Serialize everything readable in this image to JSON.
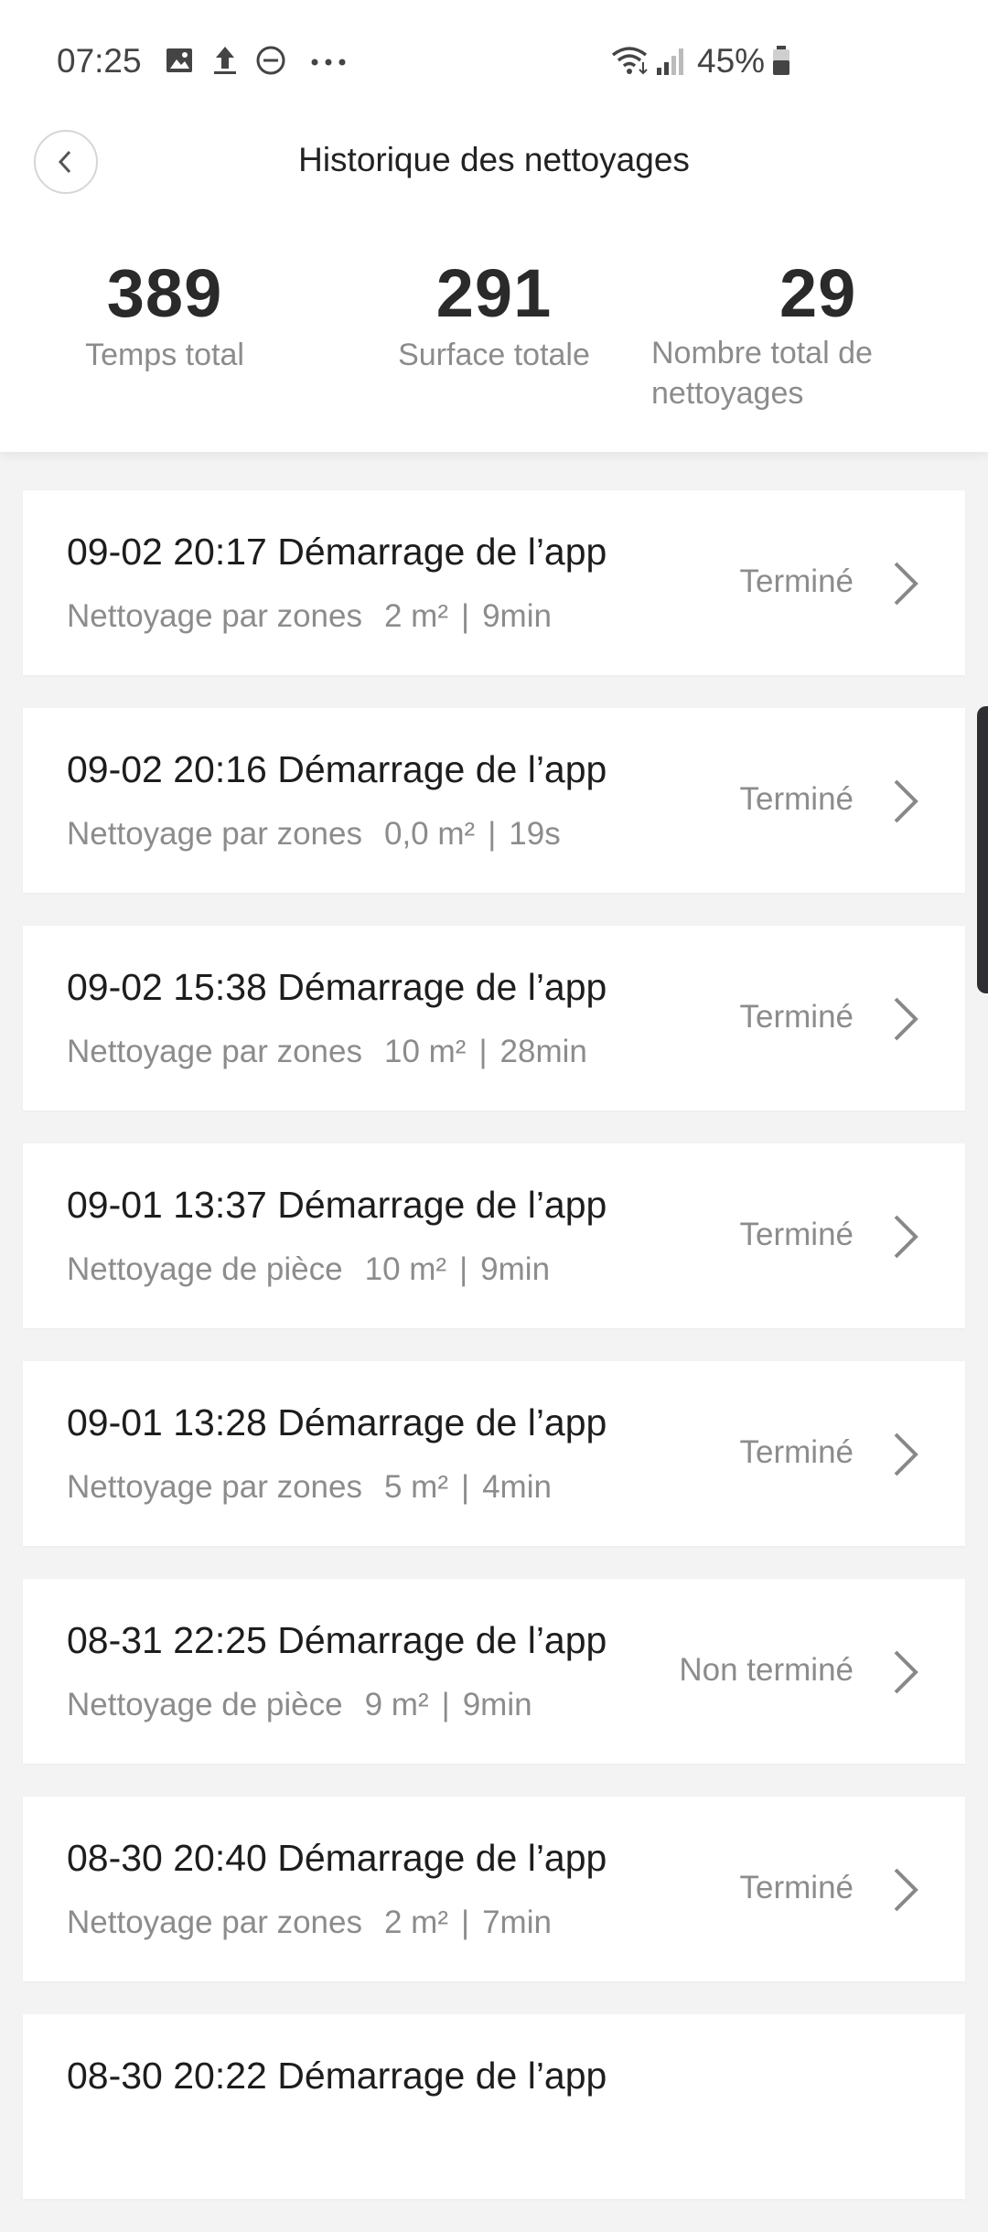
{
  "status_bar": {
    "time": "07:25",
    "battery": "45%",
    "icons": [
      "gallery-icon",
      "upload-icon",
      "do-not-disturb-icon",
      "more-dots-icon",
      "wifi-icon",
      "signal-icon",
      "battery-icon"
    ]
  },
  "header": {
    "title": "Historique des nettoyages",
    "back_icon": "chevron-left-icon"
  },
  "stats": [
    {
      "value": "389",
      "label": "Temps total"
    },
    {
      "value": "291",
      "label": "Surface totale"
    },
    {
      "value": "29",
      "label": "Nombre total de nettoyages"
    }
  ],
  "records": [
    {
      "title": "09-02 20:17 Démarrage de l’app",
      "mode": "Nettoyage par zones",
      "area": "2 m²",
      "sep": "|",
      "duration": "9min",
      "status": "Terminé"
    },
    {
      "title": "09-02 20:16 Démarrage de l’app",
      "mode": "Nettoyage par zones",
      "area": "0,0 m²",
      "sep": "|",
      "duration": "19s",
      "status": "Terminé"
    },
    {
      "title": "09-02 15:38 Démarrage de l’app",
      "mode": "Nettoyage par zones",
      "area": "10 m²",
      "sep": "|",
      "duration": "28min",
      "status": "Terminé"
    },
    {
      "title": "09-01 13:37 Démarrage de l’app",
      "mode": "Nettoyage de pièce",
      "area": "10 m²",
      "sep": "|",
      "duration": "9min",
      "status": "Terminé"
    },
    {
      "title": "09-01 13:28 Démarrage de l’app",
      "mode": "Nettoyage par zones",
      "area": "5 m²",
      "sep": "|",
      "duration": "4min",
      "status": "Terminé"
    },
    {
      "title": "08-31 22:25 Démarrage de l’app",
      "mode": "Nettoyage de pièce",
      "area": "9 m²",
      "sep": "|",
      "duration": "9min",
      "status": "Non terminé"
    },
    {
      "title": "08-30 20:40 Démarrage de l’app",
      "mode": "Nettoyage par zones",
      "area": "2 m²",
      "sep": "|",
      "duration": "7min",
      "status": "Terminé"
    },
    {
      "title": "08-30 20:22 Démarrage de l’app",
      "mode": "",
      "area": "",
      "sep": "",
      "duration": "",
      "status": ""
    }
  ],
  "colors": {
    "background": "#f3f3f3",
    "card": "#ffffff",
    "primary_text": "#1d1d1d",
    "secondary_text": "#8c8c8c"
  }
}
